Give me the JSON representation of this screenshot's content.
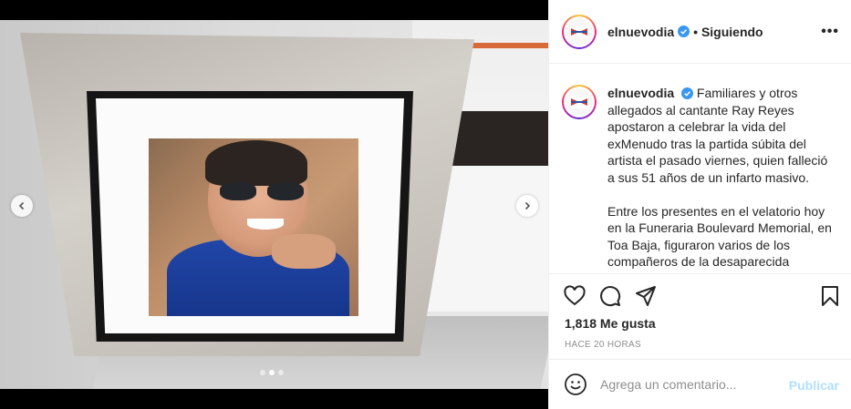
{
  "post": {
    "image_alt": "",
    "carousel": {
      "count": 3,
      "active_index": 1
    }
  },
  "account": {
    "username": "elnuevodia",
    "verified": true,
    "follow_status": "Siguiendo"
  },
  "caption": {
    "username": "elnuevodia",
    "paragraphs": [
      "Familiares y otros allegados al cantante Ray Reyes apostaron a celebrar la vida del exMenudo tras la partida súbita del artista el pasado viernes, quien falleció a sus 51 años de un infarto masivo.",
      "Entre los presentes en el velatorio hoy en la Funeraria Boulevard Memorial, en Toa Baja, figuraron varios de los compañeros de la desaparecida"
    ]
  },
  "stats": {
    "likes": "1,818 Me gusta",
    "timestamp": "HACE 20 HORAS"
  },
  "comment": {
    "placeholder": "Agrega un comentario...",
    "publish_label": "Publicar"
  },
  "icons": {
    "like": "heart-icon",
    "comment": "comment-bubble-icon",
    "share": "paper-plane-icon",
    "save": "bookmark-icon",
    "more": "more-options-icon",
    "emoji": "emoji-icon",
    "verified": "verified-badge-icon",
    "prev": "chevron-left-icon",
    "next": "chevron-right-icon"
  },
  "colors": {
    "verified_blue": "#3897f0",
    "publish_disabled": "#b2dffc",
    "muted_text": "#8e8e8e",
    "border": "#efefef"
  }
}
